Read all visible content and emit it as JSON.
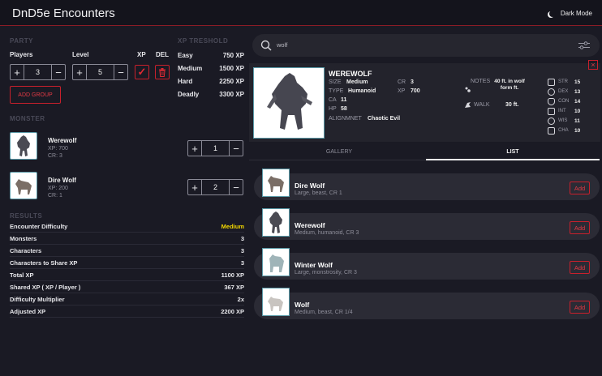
{
  "app": {
    "title": "DnD5e Encounters",
    "dark_mode_label": "Dark Mode"
  },
  "party": {
    "heading": "PARTY",
    "players_label": "Players",
    "level_label": "Level",
    "xp_label": "XP",
    "del_label": "DEL",
    "players_value": "3",
    "level_value": "5",
    "add_group_label": "ADD GROUP"
  },
  "xp_threshold": {
    "heading": "XP TRESHOLD",
    "rows": [
      {
        "label": "Easy",
        "value": "750 XP"
      },
      {
        "label": "Medium",
        "value": "1500 XP"
      },
      {
        "label": "Hard",
        "value": "2250 XP"
      },
      {
        "label": "Deadly",
        "value": "3300 XP"
      }
    ]
  },
  "monster": {
    "heading": "MONSTER",
    "items": [
      {
        "name": "Werewolf",
        "xp": "XP: 700",
        "cr": "CR: 3",
        "count": "1"
      },
      {
        "name": "Dire Wolf",
        "xp": "XP: 200",
        "cr": "CR: 1",
        "count": "2"
      }
    ]
  },
  "results": {
    "heading": "RESULTS",
    "rows": [
      {
        "label": "Encounter Difficulty",
        "value": "Medium"
      },
      {
        "label": "Monsters",
        "value": "3"
      },
      {
        "label": "Characters",
        "value": "3"
      },
      {
        "label": "Characters to Share XP",
        "value": "3"
      },
      {
        "label": "Total XP",
        "value": "1100 XP"
      },
      {
        "label": "Shared XP ( XP / Player )",
        "value": "367 XP"
      },
      {
        "label": "Difficulty Multiplier",
        "value": "2x"
      },
      {
        "label": "Adjusted XP",
        "value": "2200 XP"
      }
    ]
  },
  "search": {
    "value": "wolf"
  },
  "detail": {
    "name": "WEREWOLF",
    "size_label": "SIZE",
    "size_value": "Medium",
    "type_label": "TYPE",
    "type_value": "Humanoid",
    "ca_label": "CA",
    "ca_value": "11",
    "hp_label": "HP",
    "hp_value": "58",
    "cr_label": "CR",
    "cr_value": "3",
    "xp_label": "XP",
    "xp_value": "700",
    "alignment_label": "ALIGNMNET",
    "alignment_value": "Chaotic Evil",
    "notes_label": "NOTES",
    "notes_value": "40 ft. in wolf form ft.",
    "walk_label": "WALK",
    "walk_value": "30 ft.",
    "stats": [
      {
        "label": "STR",
        "value": "15"
      },
      {
        "label": "DEX",
        "value": "13"
      },
      {
        "label": "CON",
        "value": "14"
      },
      {
        "label": "INT",
        "value": "10"
      },
      {
        "label": "WIS",
        "value": "11"
      },
      {
        "label": "CHA",
        "value": "10"
      }
    ]
  },
  "tabs": [
    {
      "label": "GALLERY",
      "active": false
    },
    {
      "label": "LIST",
      "active": true
    }
  ],
  "list": {
    "add_label": "Add",
    "items": [
      {
        "name": "Dire Wolf",
        "sub": "Large, beast, CR 1"
      },
      {
        "name": "Werewolf",
        "sub": "Medium, humanoid, CR 3"
      },
      {
        "name": "Winter Wolf",
        "sub": "Large, monstrosity, CR 3"
      },
      {
        "name": "Wolf",
        "sub": "Medium, beast, CR 1/4"
      }
    ]
  },
  "colors": {
    "accent": "#c8202c",
    "highlight": "#f2d600",
    "background": "#1a1a24"
  }
}
